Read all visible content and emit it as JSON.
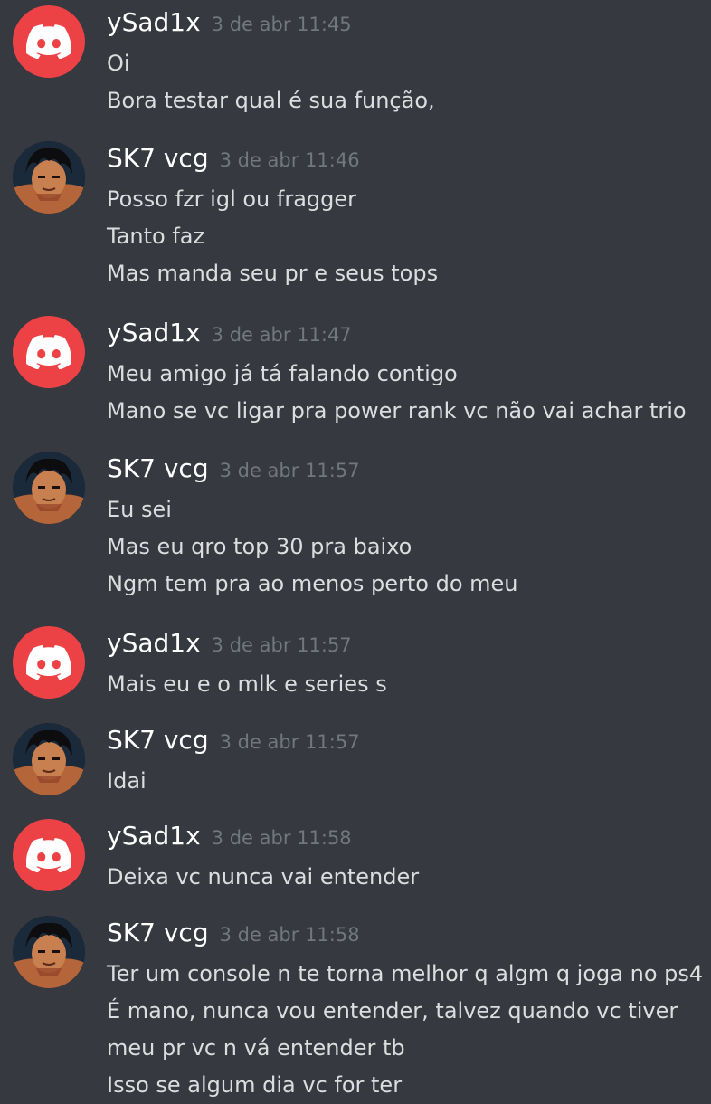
{
  "colors": {
    "background": "#36393f",
    "username": "#ffffff",
    "timestamp": "#72767d",
    "message_text": "#dcddde",
    "discord_avatar": "#ed4245"
  },
  "messages": [
    {
      "author": "ySad1x",
      "avatar": "discord-default-avatar-icon",
      "timestamp": "3 de abr 11:45",
      "lines": [
        "Oi",
        "Bora testar qual é sua função,"
      ]
    },
    {
      "author": "SK7 vcg",
      "avatar": "anime-profile-avatar",
      "timestamp": "3 de abr 11:46",
      "lines": [
        "Posso fzr igl ou fragger",
        "Tanto faz",
        "Mas manda seu pr e seus tops"
      ]
    },
    {
      "author": "ySad1x",
      "avatar": "discord-default-avatar-icon",
      "timestamp": "3 de abr 11:47",
      "lines": [
        "Meu amigo já tá falando contigo",
        "Mano se vc ligar pra power rank vc não vai achar trio"
      ]
    },
    {
      "author": "SK7 vcg",
      "avatar": "anime-profile-avatar",
      "timestamp": "3 de abr 11:57",
      "lines": [
        "Eu sei",
        "Mas eu qro top 30 pra baixo",
        "Ngm tem pra ao menos perto do meu"
      ]
    },
    {
      "author": "ySad1x",
      "avatar": "discord-default-avatar-icon",
      "timestamp": "3 de abr 11:57",
      "lines": [
        "Mais eu e o mlk e series s"
      ]
    },
    {
      "author": "SK7 vcg",
      "avatar": "anime-profile-avatar",
      "timestamp": "3 de abr 11:57",
      "lines": [
        "Idai"
      ]
    },
    {
      "author": "ySad1x",
      "avatar": "discord-default-avatar-icon",
      "timestamp": "3 de abr 11:58",
      "lines": [
        "Deixa vc nunca vai entender"
      ]
    },
    {
      "author": "SK7 vcg",
      "avatar": "anime-profile-avatar",
      "timestamp": "3 de abr 11:58",
      "lines": [
        "Ter um console n te torna melhor q algm q joga no ps4",
        "É mano, nunca vou entender, talvez quando vc tiver",
        "meu pr vc n vá entender tb",
        "Isso se algum dia vc for ter"
      ]
    }
  ]
}
